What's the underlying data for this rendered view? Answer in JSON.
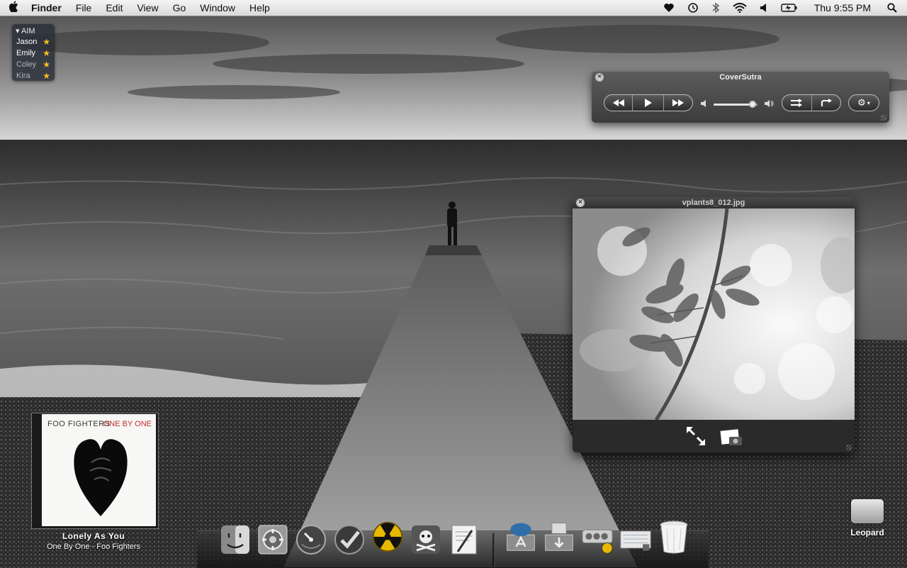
{
  "menubar": {
    "apple": "",
    "app_name": "Finder",
    "items": [
      "File",
      "Edit",
      "View",
      "Go",
      "Window",
      "Help"
    ],
    "status_icons": [
      "heart-icon",
      "time-machine-icon",
      "bluetooth-icon",
      "wifi-icon",
      "volume-icon",
      "battery-icon"
    ],
    "clock": "Thu 9:55 PM",
    "search_icon": "spotlight-icon"
  },
  "aim": {
    "header": "AIM",
    "buddies": [
      {
        "name": "Jason",
        "status": "available"
      },
      {
        "name": "Emily",
        "status": "available"
      },
      {
        "name": "Coley",
        "status": "away"
      },
      {
        "name": "Kira",
        "status": "away"
      }
    ]
  },
  "coversutra": {
    "title": "CoverSutra",
    "volume": 0.88,
    "buttons": [
      "rewind-icon",
      "play-icon",
      "fast-forward-icon",
      "shuffle-icon",
      "repeat-icon",
      "gear-icon"
    ]
  },
  "quicklook": {
    "title": "vplants8_012.jpg",
    "tools": [
      "fullscreen-icon",
      "add-to-iphoto-icon"
    ]
  },
  "album": {
    "band": "FOO FIGHTERS",
    "album": "ONE BY ONE",
    "song": "Lonely As You",
    "subtitle": "One By One - Foo Fighters"
  },
  "dock": {
    "apps": [
      "finder-icon",
      "system-preferences-icon",
      "istat-icon",
      "check-icon",
      "nuke-icon",
      "pirate-icon",
      "textedit-icon",
      "applications-stack-icon",
      "downloads-stack-icon",
      "radio-icon",
      "widget-folder-icon",
      "trash-icon"
    ]
  },
  "desktop": {
    "drive_label": "Leopard"
  }
}
